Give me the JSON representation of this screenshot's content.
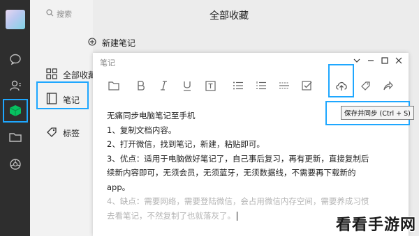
{
  "app": {
    "section_title": "全部收藏",
    "search_placeholder": "搜索",
    "new_note_label": "新建笔记"
  },
  "sidebar": {
    "items": [
      {
        "label": "全部收藏",
        "icon": "grid-icon"
      },
      {
        "label": "笔记",
        "icon": "note-icon"
      },
      {
        "label": "标签",
        "icon": "tag-icon"
      }
    ]
  },
  "rail": {
    "icons": [
      "chat-icon",
      "contacts-icon",
      "favorites-cube-icon",
      "folder-icon",
      "moments-icon"
    ],
    "active_color": "#07c160",
    "highlight_color": "#1ea7ff"
  },
  "note_window": {
    "title": "笔记",
    "controls": {
      "pin": "⌄",
      "minimize": "—",
      "maximize": "☐",
      "close": "✕"
    },
    "toolbar": [
      "folder-icon",
      "bold-icon",
      "italic-icon",
      "underline-icon",
      "text-box-icon",
      "bullet-list-icon",
      "numbered-list-icon",
      "divider-icon",
      "checkbox-icon",
      "upload-sync-icon",
      "tag-icon",
      "share-icon"
    ],
    "tooltip": "保存并同步 (Ctrl + S)",
    "lines": [
      "无痛同步电脑笔记至手机",
      "1、复制文档内容。",
      "2、打开微信，找到笔记，新建，粘贴即可。",
      "3、优点：适用于电脑做好笔记了，自己事后复习，再有更新，直接复制后",
      "续新内容即可，无须会员，无须蓝牙，无须数据线，不需要再下载新的",
      "app。",
      "4、缺点：需要网络，需要登陆微信，会占用微信内存空间，需要养成习惯",
      "去看笔记，不然复制了也就落灰了。"
    ]
  },
  "watermark": "看看手游网"
}
